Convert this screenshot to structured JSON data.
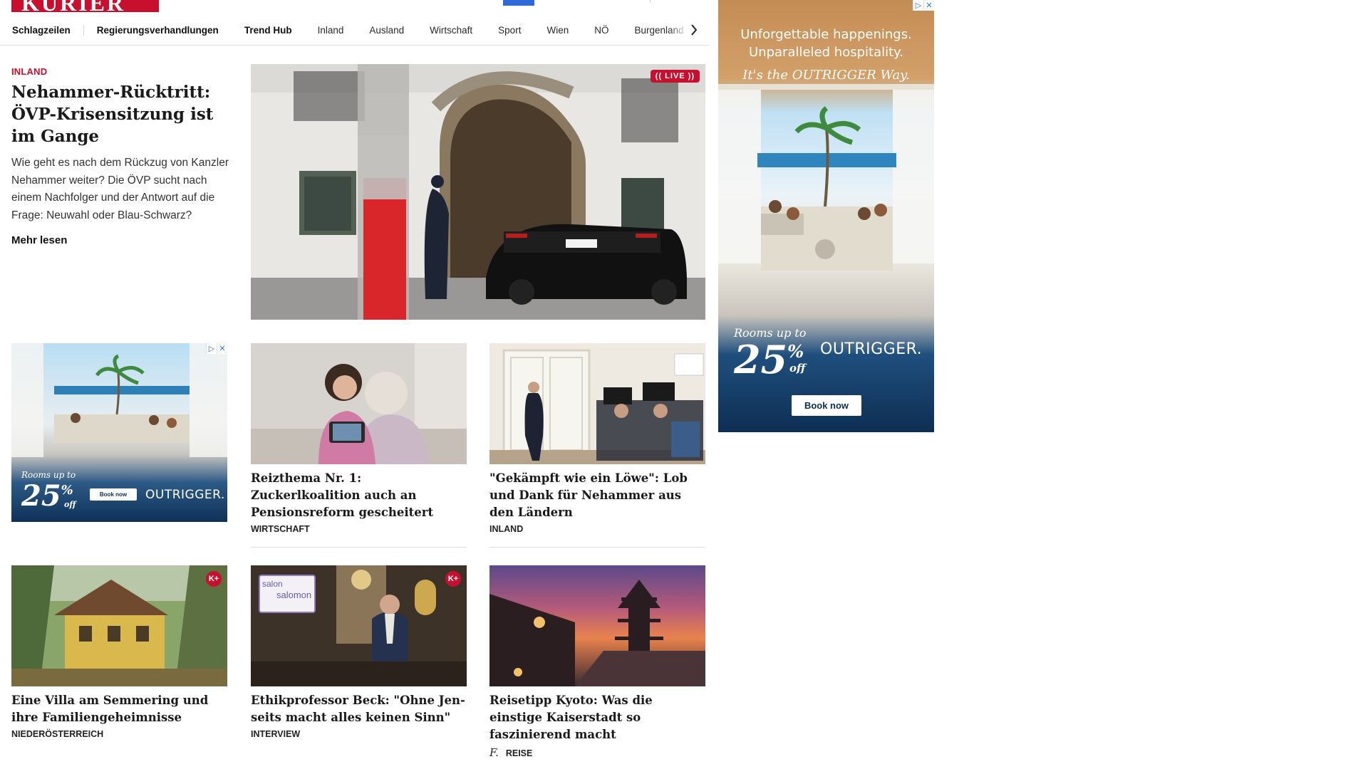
{
  "logo": {
    "text": "KURIER"
  },
  "nav": {
    "items": [
      {
        "label": "Schlagzeilen"
      },
      {
        "label": "Regierungsverhandlungen"
      },
      {
        "label": "Trend Hub"
      },
      {
        "label": "Inland"
      },
      {
        "label": "Ausland"
      },
      {
        "label": "Wirtschaft"
      },
      {
        "label": "Sport"
      },
      {
        "label": "Wien"
      },
      {
        "label": "NÖ"
      },
      {
        "label": "Burgenland"
      }
    ],
    "next_icon": "chevron-right-icon"
  },
  "hero": {
    "kicker": "INLAND",
    "title": "Nehammer-Rücktritt: ÖVP-Krisensitzung ist im Gange",
    "teaser": "Wie geht es nach dem Rückzug von Kanzler Nehammer weiter? Die ÖVP sucht nach einem Nachfolger und der Antwort auf die Frage: Neuwahl oder Blau-Schwarz?",
    "more": "Mehr lesen",
    "badge": "(( LIVE ))"
  },
  "cards": [
    {
      "title": "Reizthema Nr. 1: Zuckerlkoalition auch an Pensionsreform gescheitert",
      "tag": "WIRTSCHAFT"
    },
    {
      "title": "\"Gekämpft wie ein Löwe\": Lob und Dank für Nehammer aus den Ländern",
      "tag": "INLAND"
    },
    {
      "title": "Eine Villa am Semmering und ihre Familiengeheimnisse",
      "tag": "NIEDERÖSTERREICH",
      "badge": "K+"
    },
    {
      "title": "Ethikprofessor Beck: \"Ohne Jen-seits macht alles keinen Sinn\"",
      "tag": "INTERVIEW",
      "badge": "K+",
      "image_text": "salon salomon"
    },
    {
      "title": "Reisetipp Kyoto: Was die einstige Kaiserstadt so faszinierend macht",
      "tag": "REISE",
      "tag_icon": "f."
    }
  ],
  "side_ad": {
    "line1": "Unforgettable happenings.",
    "line2": "Unparalleled hospitality.",
    "line3": "It's the OUTRIGGER Way.",
    "rooms": "Rooms up to",
    "discount": "25",
    "percent": "%",
    "off": "off",
    "brand": "OUTRIGGER.",
    "cta": "Book now"
  },
  "inline_ad": {
    "rooms": "Rooms up to",
    "discount": "25",
    "percent": "%",
    "off": "off",
    "brand": "OUTRIGGER.",
    "cta": "Book now"
  },
  "ad_controls": {
    "adchoices": "▷",
    "close": "✕"
  },
  "colors": {
    "brand_red": "#c8102e",
    "ad_navy": "#0d2e52",
    "link_blue": "#2a78c8"
  }
}
